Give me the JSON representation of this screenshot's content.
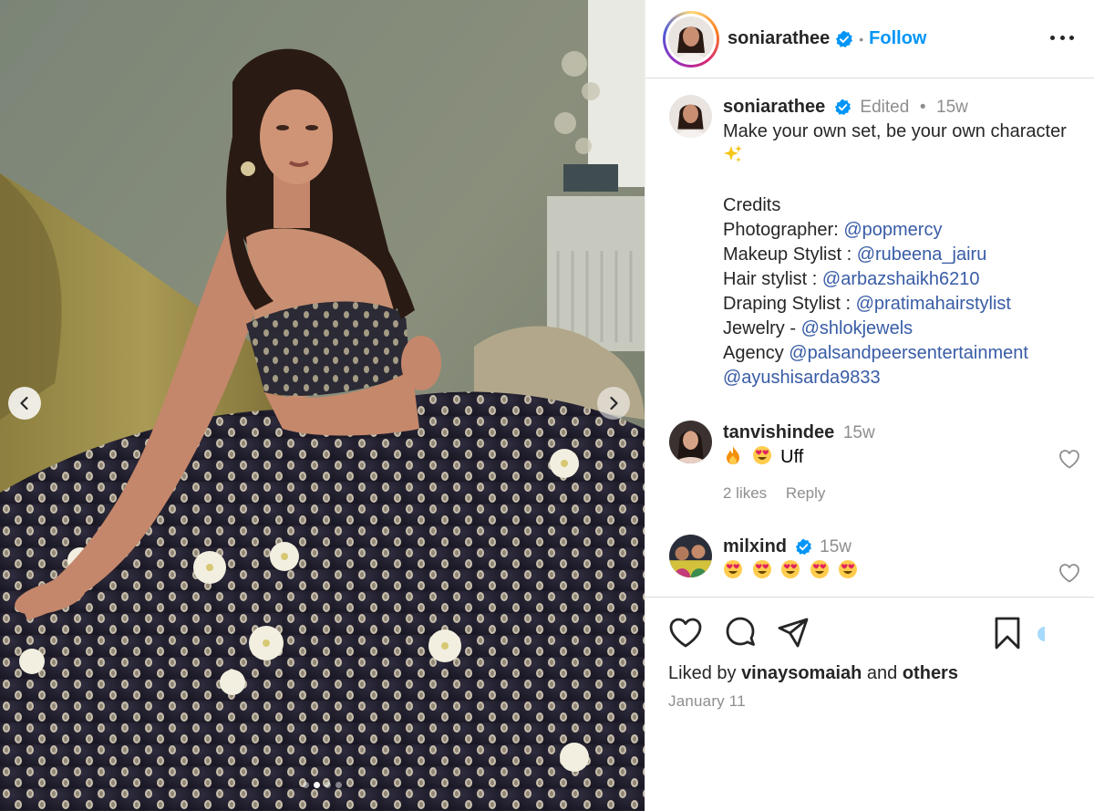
{
  "post": {
    "author": "soniarathee",
    "follow_label": "Follow",
    "separator": "•",
    "edited_label": "Edited",
    "caption_time": "15w",
    "caption_line1": "Make your own set, be your own character",
    "caption_emoji": "sparkles",
    "credits_heading": "Credits",
    "credits": [
      {
        "label": "Photographer: ",
        "handle": "@popmercy"
      },
      {
        "label": "Makeup Stylist : ",
        "handle": "@rubeena_jairu"
      },
      {
        "label": "Hair stylist : ",
        "handle": "@arbazshaikh6210"
      },
      {
        "label": "Draping Stylist : ",
        "handle": "@pratimahairstylist"
      },
      {
        "label": "Jewelry - ",
        "handle": "@shlokjewels"
      },
      {
        "label": "Agency ",
        "handle": "@palsandpeersentertainment"
      }
    ],
    "extra_handle": "@ayushisarda9833"
  },
  "comments": [
    {
      "author": "tanvishindee",
      "time": "15w",
      "emojis": [
        "fire",
        "heart-eyes"
      ],
      "text": "Uff",
      "likes": "2 likes",
      "reply": "Reply",
      "verified": false
    },
    {
      "author": "milxind",
      "time": "15w",
      "emojis": [
        "heart-eyes",
        "heart-eyes",
        "heart-eyes",
        "heart-eyes",
        "heart-eyes"
      ],
      "text": "",
      "verified": true
    }
  ],
  "footer": {
    "liked_by_prefix": "Liked by ",
    "liked_by_user": "vinaysomaiah",
    "liked_by_and": " and ",
    "liked_by_others": "others",
    "date": "January 11"
  },
  "carousel": {
    "current": 2,
    "total": 4
  },
  "colors": {
    "link": "#385ca6",
    "follow": "#0095f6",
    "verified": "#0095f6",
    "muted": "#8e8e8e"
  },
  "icons": [
    "chevron-left-icon",
    "chevron-right-icon",
    "verified-badge-icon",
    "more-options-icon",
    "heart-icon",
    "comment-icon",
    "share-icon",
    "bookmark-icon"
  ]
}
